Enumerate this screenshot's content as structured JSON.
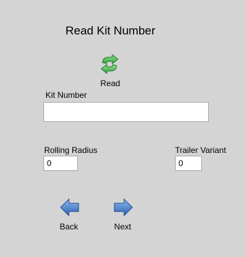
{
  "page": {
    "title": "Read Kit Number"
  },
  "read_button": {
    "label": "Read",
    "icon": "refresh-icon"
  },
  "kit_number": {
    "label": "Kit Number",
    "value": ""
  },
  "rolling_radius": {
    "label": "Rolling Radius",
    "value": "0"
  },
  "trailer_variant": {
    "label": "Trailer Variant",
    "value": "0"
  },
  "navigation": {
    "back_label": "Back",
    "back_icon": "arrow-left-icon",
    "next_label": "Next",
    "next_icon": "arrow-right-icon"
  },
  "colors": {
    "background": "#d4d4d4",
    "refresh_icon": "#4fbf4f",
    "nav_arrows": "#3b78c4"
  }
}
